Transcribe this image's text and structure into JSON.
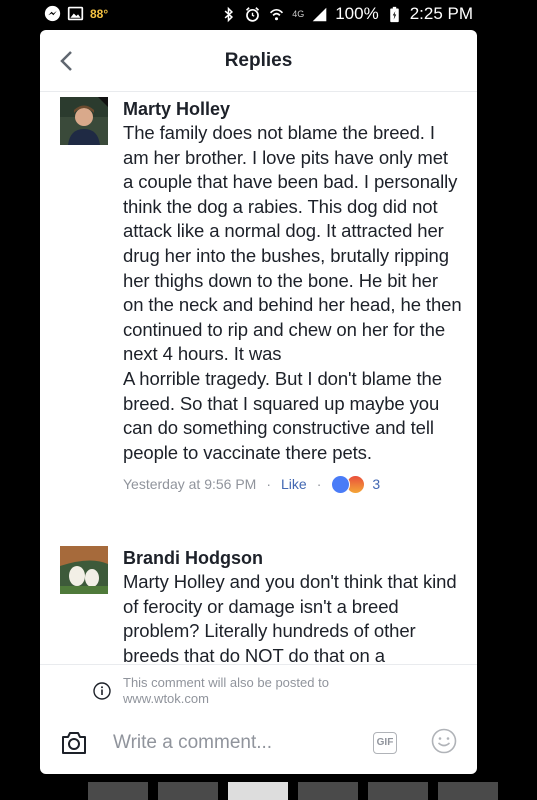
{
  "status_bar": {
    "temperature": "88°",
    "network": "4G",
    "battery": "100%",
    "time": "2:25 PM",
    "icons": [
      "messenger-icon",
      "image-icon",
      "bluetooth-icon",
      "alarm-icon",
      "wifi-icon",
      "signal-icon",
      "battery-icon"
    ]
  },
  "header": {
    "title": "Replies"
  },
  "comments": [
    {
      "author": "Marty Holley",
      "text": "The family does not blame the breed. I am her brother. I love pits have only met a couple that have been bad. I personally think the dog a rabies. This dog did not attack like a normal dog. It attracted her drug her into the bushes, brutally ripping her thighs down to the bone. He bit her on the neck and behind her head, he then continued to rip and chew on her for the next 4 hours. It was\nA horrible tragedy. But I don't blame the breed. So that I squared up maybe you can do something constructive and tell people to vaccinate there pets.",
      "timestamp": "Yesterday at 9:56 PM",
      "like_label": "Like",
      "reactions": [
        "like",
        "angry"
      ],
      "reaction_count": "3"
    },
    {
      "author": "Brandi Hodgson",
      "text": "Marty Holley and you don't think that kind of ferocity or damage isn't a breed problem? Literally hundreds of other breeds that do NOT do that on a"
    }
  ],
  "notice": {
    "text_line1": "This comment will also be posted to",
    "text_line2": "www.wtok.com"
  },
  "composer": {
    "placeholder": "Write a comment...",
    "gif_label": "GIF"
  },
  "colors": {
    "accent": "#4267b2",
    "meta": "#90949c",
    "text": "#1d2129"
  }
}
